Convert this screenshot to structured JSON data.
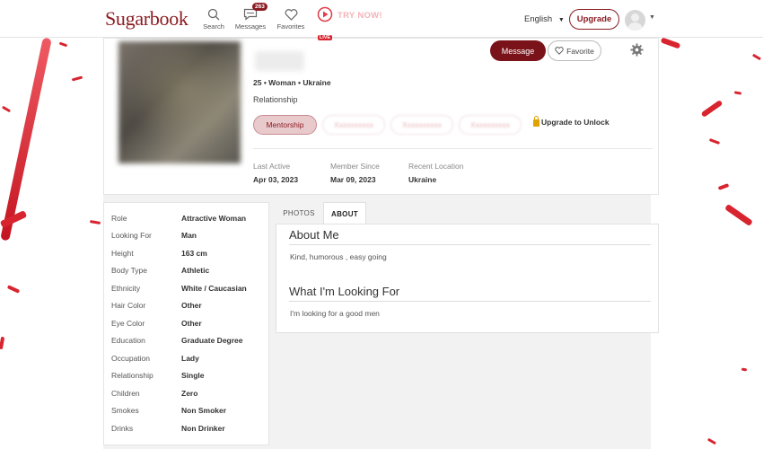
{
  "header": {
    "logo": "Sugarbook",
    "nav": [
      {
        "label": "Search"
      },
      {
        "label": "Messages",
        "badge": "263"
      },
      {
        "label": "Favorites"
      }
    ],
    "live_label": "LIVE",
    "try_now": "TRY NOW!",
    "language": "English",
    "upgrade_label": "Upgrade"
  },
  "profile": {
    "meta": "25 • Woman • Ukraine",
    "relationship": "Relationship",
    "tag_main": "Mentorship",
    "tag_blurred": [
      "Xxxxxxxxxx",
      "Xxxxxxxxxx",
      "Xxxxxxxxxx"
    ],
    "unlock_label": "Upgrade to Unlock",
    "message_label": "Message",
    "favorite_label": "Favorite",
    "stats": [
      {
        "label": "Last Active",
        "value": "Apr 03, 2023"
      },
      {
        "label": "Member Since",
        "value": "Mar 09, 2023"
      },
      {
        "label": "Recent Location",
        "value": "Ukraine"
      }
    ]
  },
  "details": [
    {
      "label": "Role",
      "value": "Attractive Woman"
    },
    {
      "label": "Looking For",
      "value": "Man"
    },
    {
      "label": "Height",
      "value": "163 cm"
    },
    {
      "label": "Body Type",
      "value": "Athletic"
    },
    {
      "label": "Ethnicity",
      "value": "White / Caucasian"
    },
    {
      "label": "Hair Color",
      "value": "Other"
    },
    {
      "label": "Eye Color",
      "value": "Other"
    },
    {
      "label": "Education",
      "value": "Graduate Degree"
    },
    {
      "label": "Occupation",
      "value": "Lady"
    },
    {
      "label": "Relationship",
      "value": "Single"
    },
    {
      "label": "Children",
      "value": "Zero"
    },
    {
      "label": "Smokes",
      "value": "Non Smoker"
    },
    {
      "label": "Drinks",
      "value": "Non Drinker"
    }
  ],
  "tabs": {
    "photos": "PHOTOS",
    "about": "ABOUT"
  },
  "about": {
    "about_me_title": "About Me",
    "about_me_text": "Kind, humorous , easy going",
    "looking_title": "What I'm Looking For",
    "looking_text": "I'm looking for a good men"
  },
  "colors": {
    "brand": "#8b1c22",
    "accent_red": "#d8242f"
  }
}
